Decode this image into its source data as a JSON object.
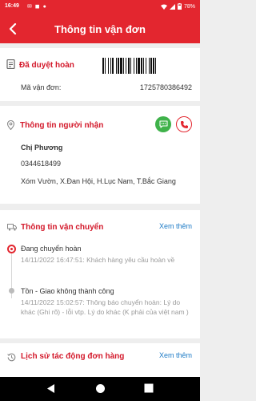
{
  "status_bar": {
    "time": "16:49",
    "battery": "78%"
  },
  "app_bar": {
    "title": "Thông tin vận đơn"
  },
  "order": {
    "status": "Đã duyệt hoàn",
    "code_label": "Mã vận đơn:",
    "code_value": "1725780386492"
  },
  "recipient": {
    "header": "Thông tin người nhận",
    "name": "Chị Phương",
    "phone": "0344618499",
    "address": "Xóm Vườn, X.Đan Hội, H.Lục Nam, T.Bắc Giang"
  },
  "shipping": {
    "header": "Thông tin vận chuyển",
    "see_more": "Xem thêm",
    "events": [
      {
        "title": "Đang chuyển hoàn",
        "desc": "14/11/2022 16:47:51: Khách hàng yêu cầu hoàn về"
      },
      {
        "title": "Tồn - Giao không thành công",
        "desc": "14/11/2022 15:02:57: Thông báo chuyển hoàn: Lý do khác (Ghi rõ) - lỗi vtp. Lý do khác (K phải của việt nam )"
      }
    ]
  },
  "history": {
    "header": "Lịch sử tác động đơn hàng",
    "see_more": "Xem thêm"
  },
  "colors": {
    "brand": "#e3262f",
    "title_red": "#d3182a",
    "link": "#1e7bc6",
    "call_green": "#3fb24a"
  },
  "icons": [
    "back-arrow-icon",
    "receipt-icon",
    "barcode-icon",
    "location-pin-icon",
    "chat-icon",
    "phone-icon",
    "truck-icon",
    "history-icon"
  ]
}
